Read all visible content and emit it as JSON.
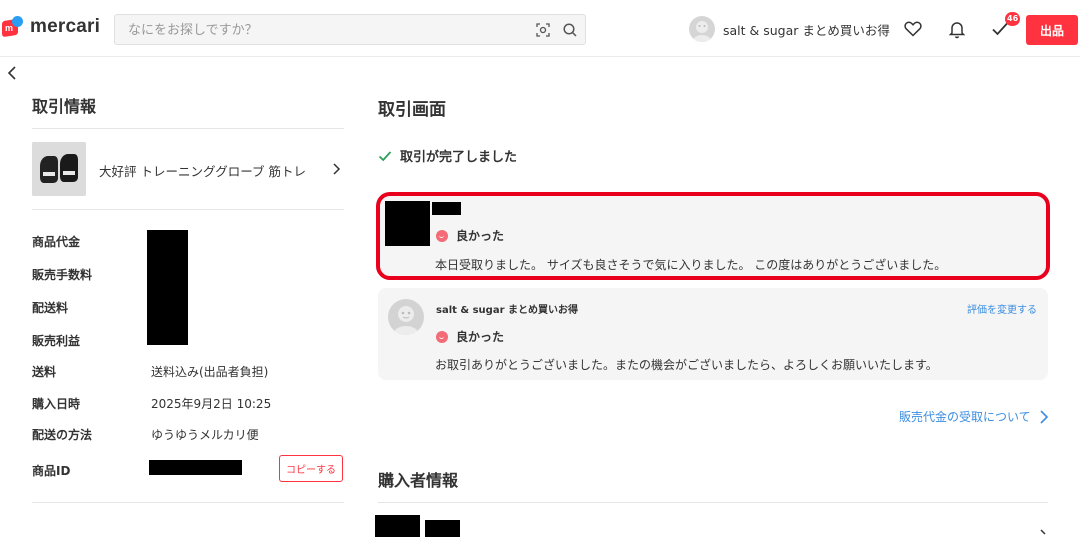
{
  "header": {
    "logo_text": "mercari",
    "logo_mark_letter": "m",
    "search_placeholder": "なにをお探しですか？",
    "user_name": "salt & sugar まとめ買いお得",
    "notification_badge": "46",
    "sell_label": "出品"
  },
  "colors": {
    "brand_red": "#ff333f",
    "link_blue": "#3c8ee0",
    "highlight_red": "#e8001c",
    "rating_pink": "#f26b77",
    "check_green": "#2e9e5b"
  },
  "transaction_info": {
    "title": "取引情報",
    "item_name": "大好評 トレーニンググローブ 筋トレ",
    "rows": [
      {
        "label": "商品代金",
        "value": ""
      },
      {
        "label": "販売手数料",
        "value": ""
      },
      {
        "label": "配送料",
        "value": ""
      },
      {
        "label": "販売利益",
        "value": ""
      },
      {
        "label": "送料",
        "value": "送料込み(出品者負担)"
      },
      {
        "label": "購入日時",
        "value": "2025年9月2日 10:25"
      },
      {
        "label": "配送の方法",
        "value": "ゆうゆうメルカリ便"
      },
      {
        "label": "商品ID",
        "value": ""
      }
    ],
    "copy_label": "コピーする"
  },
  "trade": {
    "title": "取引画面",
    "status": "取引が完了しました",
    "buyer_review": {
      "rating": "良かった",
      "comment": "本日受取りました。 サイズも良さそうで気に入りました。 この度はありがとうございました。"
    },
    "seller_review": {
      "reviewer": "salt & sugar まとめ買いお得",
      "change_label": "評価を変更する",
      "rating": "良かった",
      "comment": "お取引ありがとうございました。またの機会がございましたら、よろしくお願いいたします。"
    },
    "payout_link": "販売代金の受取について",
    "buyer_info_title": "購入者情報"
  },
  "icons": [
    "search-icon",
    "scan-icon",
    "heart-icon",
    "bell-icon",
    "todo-check-icon",
    "back-chevron-icon",
    "chevron-right-icon",
    "check-icon",
    "smile-dot-icon"
  ]
}
